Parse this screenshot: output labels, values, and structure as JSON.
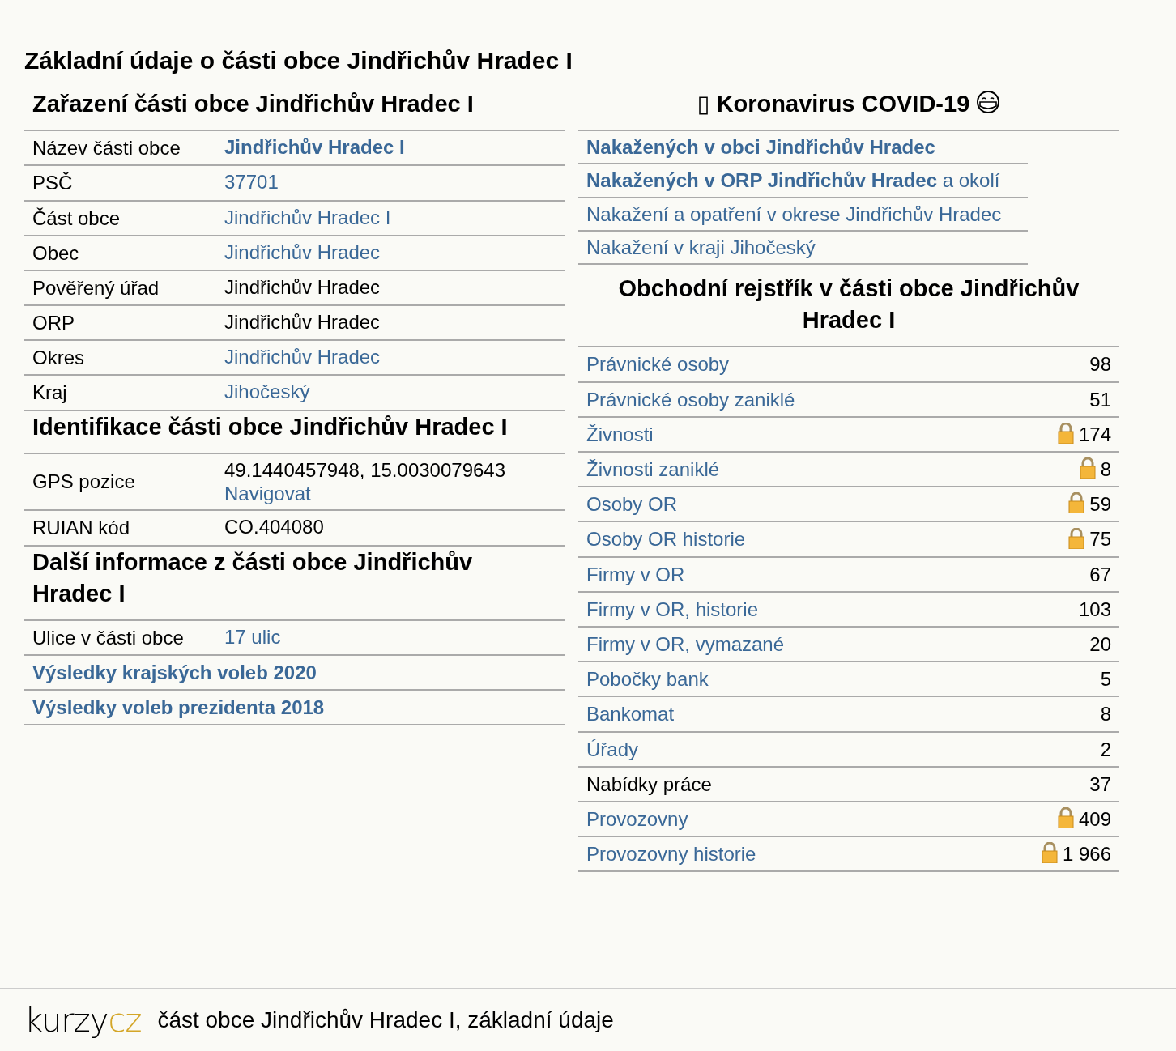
{
  "page_title": "Základní údaje o části obce Jindřichův Hradec I",
  "left_sections": [
    {
      "heading": "Zařazení části obce Jindřichův Hradec I",
      "rows": [
        {
          "kind": "pair",
          "label": "Název části obce",
          "values": [
            {
              "text": "Jindřichův Hradec I",
              "link": true,
              "bold": true
            }
          ]
        },
        {
          "kind": "pair",
          "label": "PSČ",
          "values": [
            {
              "text": "37701",
              "link": true,
              "bold": false
            }
          ]
        },
        {
          "kind": "pair",
          "label": "Část obce",
          "values": [
            {
              "text": "Jindřichův Hradec I",
              "link": true,
              "bold": false
            }
          ]
        },
        {
          "kind": "pair",
          "label": "Obec",
          "values": [
            {
              "text": "Jindřichův Hradec",
              "link": true,
              "bold": false
            }
          ]
        },
        {
          "kind": "pair",
          "label": "Pověřený úřad",
          "values": [
            {
              "text": "Jindřichův Hradec",
              "link": false,
              "bold": false
            }
          ]
        },
        {
          "kind": "pair",
          "label": "ORP",
          "values": [
            {
              "text": "Jindřichův Hradec",
              "link": false,
              "bold": false
            }
          ]
        },
        {
          "kind": "pair",
          "label": "Okres",
          "values": [
            {
              "text": "Jindřichův Hradec",
              "link": true,
              "bold": false
            }
          ]
        },
        {
          "kind": "pair",
          "label": "Kraj",
          "values": [
            {
              "text": "Jihočeský",
              "link": true,
              "bold": false
            }
          ]
        }
      ]
    },
    {
      "heading": "Identifikace části obce Jindřichův Hradec I",
      "rows": [
        {
          "kind": "pair",
          "label": "GPS pozice",
          "values": [
            {
              "text": "49.1440457948, 15.0030079643",
              "link": false,
              "bold": false
            },
            {
              "text": "Navigovat",
              "link": true,
              "bold": false
            }
          ]
        },
        {
          "kind": "pair",
          "label": "RUIAN kód",
          "values": [
            {
              "text": "CO.404080",
              "link": false,
              "bold": false
            }
          ]
        }
      ]
    },
    {
      "heading": "Další informace z části obce Jindřichův Hradec I",
      "rows": [
        {
          "kind": "pair",
          "label": "Ulice v části obce",
          "values": [
            {
              "text": "17 ulic",
              "link": true,
              "bold": false
            }
          ]
        },
        {
          "kind": "link",
          "text": "Výsledky krajských voleb 2020"
        },
        {
          "kind": "link",
          "text": "Výsledky voleb prezidenta 2018"
        }
      ]
    }
  ],
  "covid": {
    "glyph": "▯",
    "title": "Koronavirus COVID-19",
    "items": [
      {
        "text": "**Nakažených v obci Jindřichův Hradec**"
      },
      {
        "text": "**Nakažených v ORP Jindřichův Hradec** a okolí"
      },
      {
        "text": "Nakažení a opatření v okrese Jindřichův Hradec"
      },
      {
        "text": "Nakažení v kraji Jihočeský"
      }
    ]
  },
  "register": {
    "heading": "Obchodní rejstřík v části obce Jindřichův Hradec I",
    "rows": [
      {
        "label": "Právnické osoby",
        "count": "98",
        "locked": false,
        "link": true
      },
      {
        "label": "Právnické osoby zaniklé",
        "count": "51",
        "locked": false,
        "link": true
      },
      {
        "label": "Živnosti",
        "count": "174",
        "locked": true,
        "link": true
      },
      {
        "label": "Živnosti zaniklé",
        "count": "8",
        "locked": true,
        "link": true
      },
      {
        "label": "Osoby OR",
        "count": "59",
        "locked": true,
        "link": true
      },
      {
        "label": "Osoby OR historie",
        "count": "75",
        "locked": true,
        "link": true
      },
      {
        "label": "Firmy v OR",
        "count": "67",
        "locked": false,
        "link": true
      },
      {
        "label": "Firmy v OR, historie",
        "count": "103",
        "locked": false,
        "link": true
      },
      {
        "label": "Firmy v OR, vymazané",
        "count": "20",
        "locked": false,
        "link": true
      },
      {
        "label": "Pobočky bank",
        "count": "5",
        "locked": false,
        "link": true
      },
      {
        "label": "Bankomat",
        "count": "8",
        "locked": false,
        "link": true
      },
      {
        "label": "Úřady",
        "count": "2",
        "locked": false,
        "link": true
      },
      {
        "label": "Nabídky práce",
        "count": "37",
        "locked": false,
        "link": false
      },
      {
        "label": "Provozovny",
        "count": "409",
        "locked": true,
        "link": true
      },
      {
        "label": "Provozovny historie",
        "count": "1 966",
        "locked": true,
        "link": true
      }
    ]
  },
  "footer": {
    "logo_main": "kurzy",
    "logo_accent": "cz",
    "caption": "část obce Jindřichův Hradec I, základní údaje"
  }
}
